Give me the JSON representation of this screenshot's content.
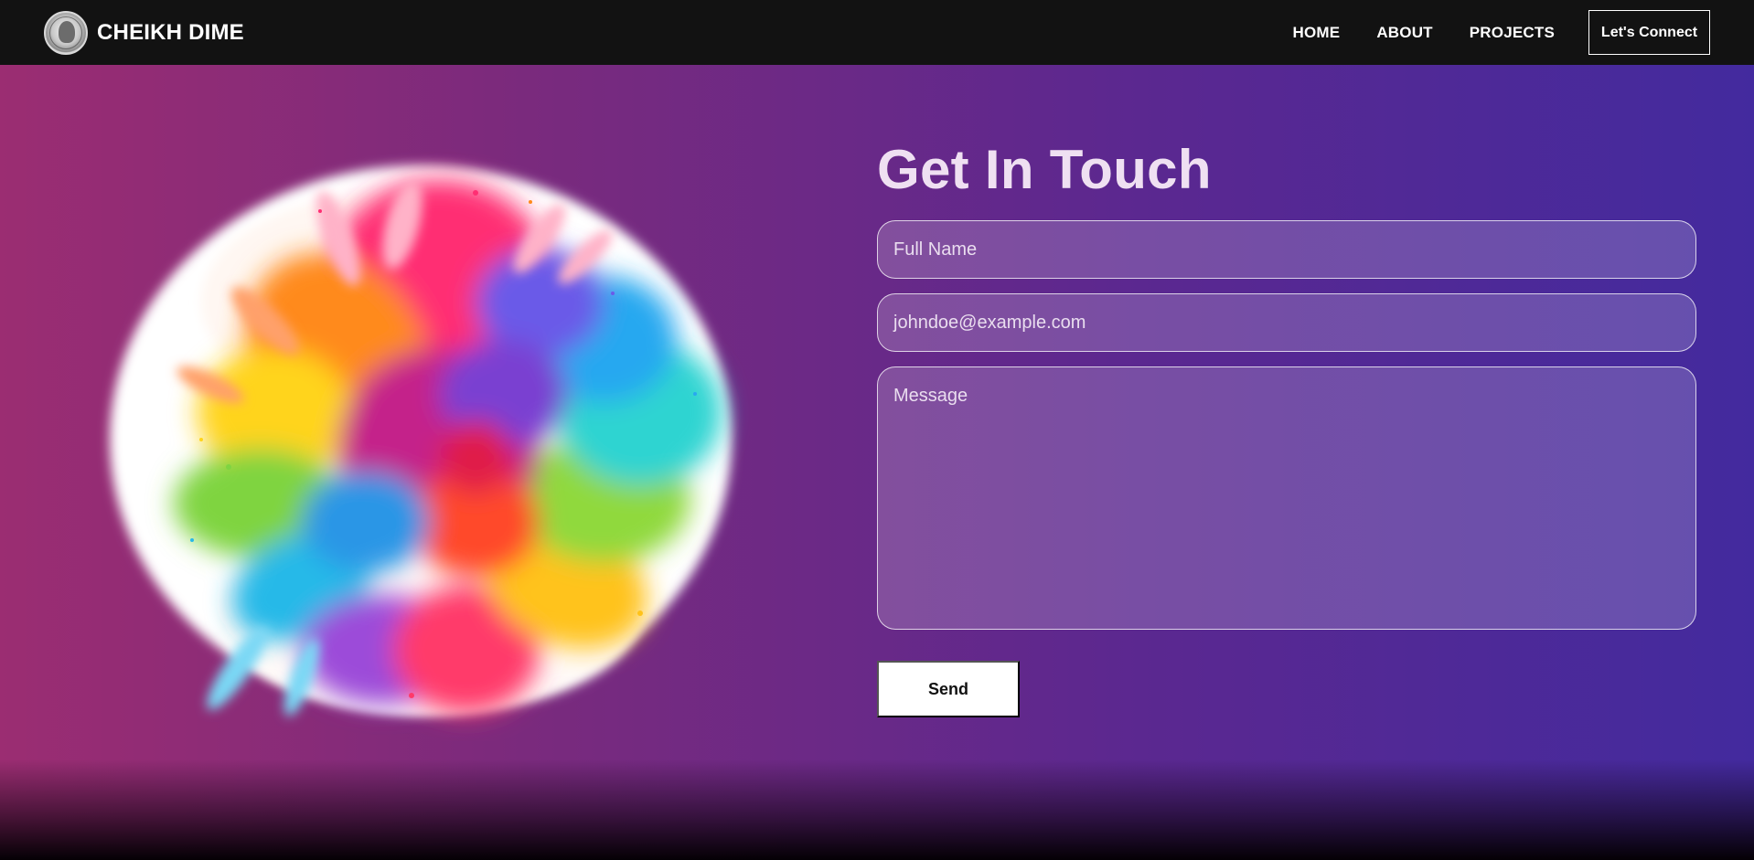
{
  "navbar": {
    "brand_name": "CHEIKH DIME",
    "logo_icon": "coin-portrait-logo",
    "links": [
      {
        "label": "HOME"
      },
      {
        "label": "ABOUT"
      },
      {
        "label": "PROJECTS"
      }
    ],
    "cta_label": "Let's Connect"
  },
  "contact": {
    "title": "Get In Touch",
    "fields": {
      "name_placeholder": "Full Name",
      "email_placeholder": "johndoe@example.com",
      "message_placeholder": "Message"
    },
    "send_label": "Send",
    "illustration": "color-powder-explosion-illustration"
  },
  "colors": {
    "nav_bg": "#121212",
    "gradient_start": "#9b2d72",
    "gradient_end": "#432a9e",
    "title_color": "#efe0f2",
    "button_bg": "#ffffff"
  }
}
